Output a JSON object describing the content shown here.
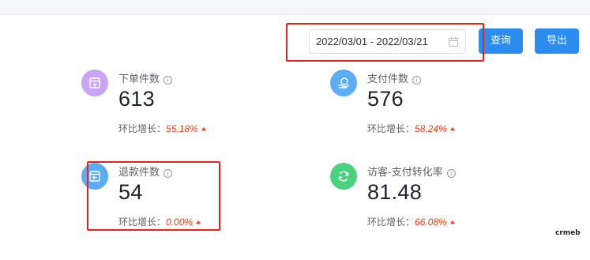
{
  "filter": {
    "date_range": "2022/03/01 - 2022/03/21",
    "search_label": "查询",
    "export_label": "导出"
  },
  "cards": [
    {
      "label": "下单件数",
      "value": "613",
      "growth_label": "环比增长：",
      "growth_value": "55.18%",
      "icon": "order-box-icon",
      "color": "#c8a5f5"
    },
    {
      "label": "支付件数",
      "value": "576",
      "growth_label": "环比增长：",
      "growth_value": "58.24%",
      "icon": "payment-hand-icon",
      "color": "#5cadf7"
    },
    {
      "label": "退款件数",
      "value": "54",
      "growth_label": "环比增长：",
      "growth_value": "0.00%",
      "icon": "refund-box-icon",
      "color": "#5cadf7"
    },
    {
      "label": "访客-支付转化率",
      "value": "81.48",
      "growth_label": "环比增长：",
      "growth_value": "66.08%",
      "icon": "refresh-cycle-icon",
      "color": "#4bd27f"
    }
  ],
  "info_glyph": "i",
  "trend_color": "#ed4014",
  "highlight_color": "#e5221e",
  "watermark": "crmeb"
}
